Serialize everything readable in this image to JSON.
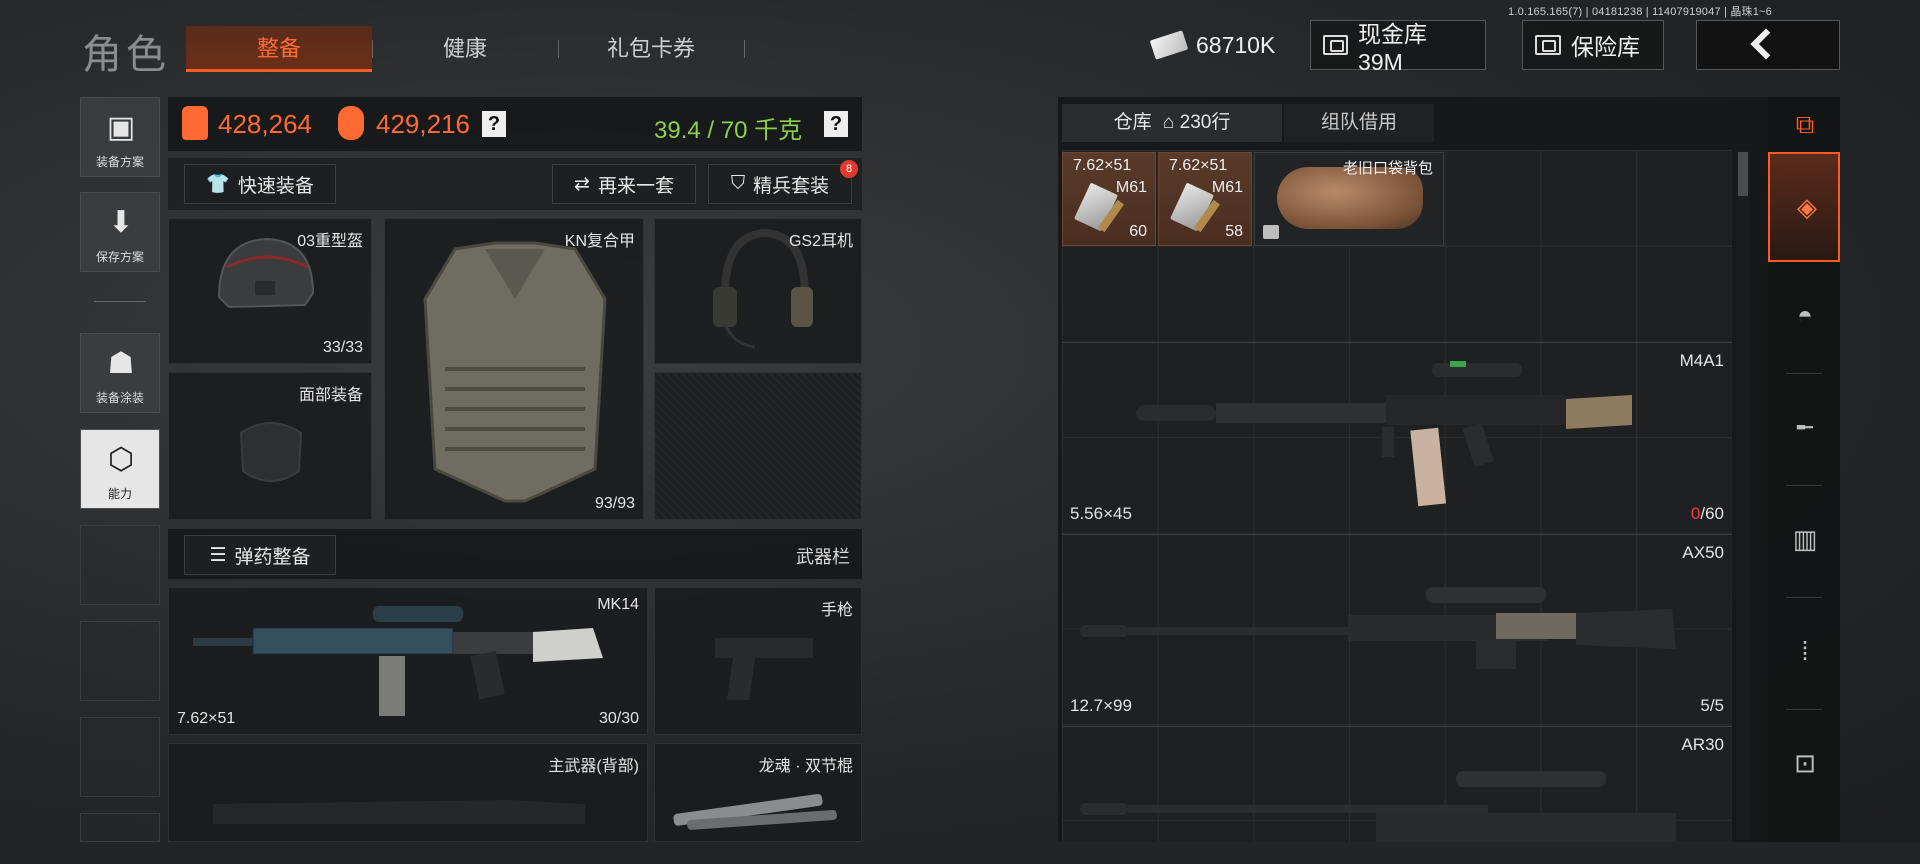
{
  "build_info": "1.0.165.165(7) | 04181238 | 11407919047 | 晶珠1~6",
  "header": {
    "title": "角色",
    "tabs": [
      {
        "label": "整备",
        "active": true
      },
      {
        "label": "健康",
        "active": false
      },
      {
        "label": "礼包卡券",
        "active": false
      }
    ],
    "money": "68710K",
    "cash_vault": "现金库 39M",
    "safe": "保险库"
  },
  "sidebar": {
    "items": [
      {
        "label": "装备方案",
        "icon": "armor-icon"
      },
      {
        "label": "保存方案",
        "icon": "download-icon"
      },
      {
        "label": "装备涂装",
        "icon": "paint-icon"
      },
      {
        "label": "能力",
        "icon": "ability-icon"
      }
    ]
  },
  "loadout": {
    "value_carried": "428,264",
    "value_total": "429,216",
    "help1": "?",
    "weight": "39.4 / 70 千克",
    "help2": "?",
    "quick_equip": "快速装备",
    "again": "再来一套",
    "elite": "精兵套装",
    "elite_badge": "8",
    "slots": {
      "helmet": {
        "name": "03重型盔",
        "durability": "33/33"
      },
      "armor": {
        "name": "KN复合甲",
        "durability": "93/93"
      },
      "headset": {
        "name": "GS2耳机"
      },
      "face": {
        "name": "面部装备"
      }
    },
    "ammo_prep": "弹药整备",
    "weapon_bar": "武器栏",
    "primary": {
      "name": "MK14",
      "caliber": "7.62×51",
      "ammo": "30/30"
    },
    "pistol": {
      "name": "手枪"
    },
    "back_weapon": {
      "name": "主武器(背部)"
    },
    "melee": {
      "name": "龙魂 · 双节棍"
    }
  },
  "warehouse": {
    "tab_storage": "仓库",
    "tab_rows": "230行",
    "tab_team": "组队借用",
    "ammo": [
      {
        "caliber": "7.62×51",
        "type": "M61",
        "count": "60"
      },
      {
        "caliber": "7.62×51",
        "type": "M61",
        "count": "58"
      }
    ],
    "bag": "老旧口袋背包",
    "guns": [
      {
        "name": "M4A1",
        "caliber": "5.56×45",
        "cap_current": "0",
        "cap_max": "/60"
      },
      {
        "name": "AX50",
        "caliber": "12.7×99",
        "cap_current": "",
        "cap_max": "5/5"
      },
      {
        "name": "AR30",
        "caliber": "",
        "cap_current": "",
        "cap_max": ""
      }
    ]
  },
  "colors": {
    "accent": "#ff5a1f",
    "weight_green": "#8bd14a",
    "value_orange": "#ff6a33"
  }
}
